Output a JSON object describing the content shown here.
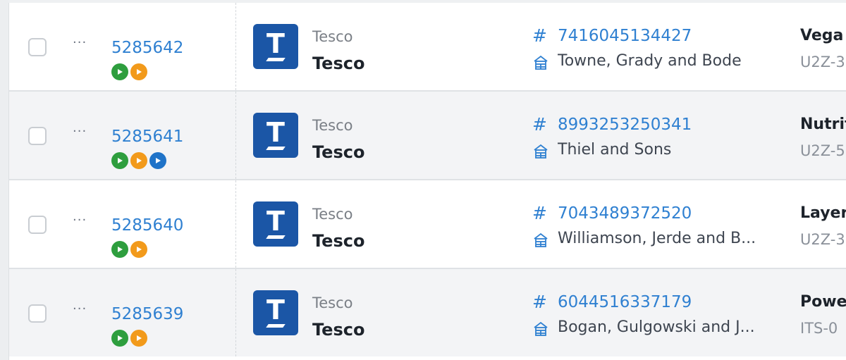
{
  "rows": [
    {
      "order_id": "5285642",
      "badges": [
        "green",
        "orange"
      ],
      "retailer_small": "Tesco",
      "retailer_big": "Tesco",
      "logo_letter": "T",
      "ref_hash": "#",
      "ref_number": "7416045134427",
      "company": "Towne, Grady and Bode",
      "product_name": "Vega",
      "product_code": "U2Z-3"
    },
    {
      "order_id": "5285641",
      "badges": [
        "green",
        "orange",
        "blue"
      ],
      "retailer_small": "Tesco",
      "retailer_big": "Tesco",
      "logo_letter": "T",
      "ref_hash": "#",
      "ref_number": "8993253250341",
      "company": "Thiel and Sons",
      "product_name": "Nutrit",
      "product_code": "U2Z-5"
    },
    {
      "order_id": "5285640",
      "badges": [
        "green",
        "orange"
      ],
      "retailer_small": "Tesco",
      "retailer_big": "Tesco",
      "logo_letter": "T",
      "ref_hash": "#",
      "ref_number": "7043489372520",
      "company": "Williamson, Jerde and B...",
      "product_name": "Layer",
      "product_code": "U2Z-3"
    },
    {
      "order_id": "5285639",
      "badges": [
        "green",
        "orange"
      ],
      "retailer_small": "Tesco",
      "retailer_big": "Tesco",
      "logo_letter": "T",
      "ref_hash": "#",
      "ref_number": "6044516337179",
      "company": "Bogan, Gulgowski and J...",
      "product_name": "Powe",
      "product_code": "ITS-0"
    }
  ],
  "more_label": "···",
  "colors": {
    "link": "#2f80d1",
    "badge_green": "#2e9e3e",
    "badge_orange": "#f29a1b",
    "badge_blue": "#1f73c8",
    "logo_bg": "#1b56a6"
  },
  "icons": {
    "row_menu": "more-dots-icon",
    "ref": "hash-icon",
    "company": "warehouse-icon",
    "badge": "play-icon"
  }
}
